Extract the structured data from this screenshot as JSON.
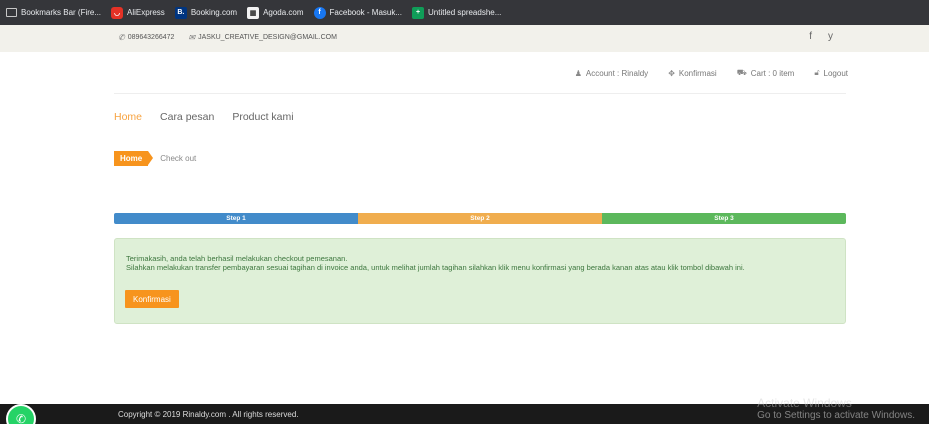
{
  "bookmarks": [
    {
      "label": "Bookmarks Bar (Fire...",
      "icon": "folder-icon"
    },
    {
      "label": "AliExpress",
      "icon": "aliexpress-icon"
    },
    {
      "label": "Booking.com",
      "icon": "booking-icon"
    },
    {
      "label": "Agoda.com",
      "icon": "agoda-icon"
    },
    {
      "label": "Facebook - Masuk...",
      "icon": "facebook-icon"
    },
    {
      "label": "Untitled spreadshe...",
      "icon": "sheets-icon"
    }
  ],
  "topbar": {
    "phone": "089643266472",
    "email": "JASKU_CREATIVE_DESIGN@GMAIL.COM",
    "social": [
      "f",
      "y"
    ]
  },
  "account_nav": {
    "account": "Account : Rinaldy",
    "konfirmasi": "Konfirmasi",
    "cart": "Cart : 0 item",
    "logout": "Logout"
  },
  "main_nav": {
    "home": "Home",
    "cara_pesan": "Cara pesan",
    "product": "Product kami"
  },
  "breadcrumb": {
    "home": "Home",
    "current": "Check out"
  },
  "steps": [
    {
      "label": "Step 1",
      "color": "#428bca"
    },
    {
      "label": "Step 2",
      "color": "#f0ad4e"
    },
    {
      "label": "Step 3",
      "color": "#5cb85c"
    }
  ],
  "alert": {
    "line1": "Terimakasih, anda telah berhasil melakukan checkout pemesanan.",
    "line2": "Silahkan melakukan transfer pembayaran sesuai tagihan di invoice anda, untuk melihat jumlah tagihan silahkan klik menu konfirmasi yang berada kanan atas atau klik tombol dibawah ini.",
    "button": "Konfirmasi"
  },
  "footer": {
    "copyright": "Copyright © 2019 Rinaldy.com . All rights reserved."
  },
  "watermark": {
    "title": "Activate Windows",
    "subtitle": "Go to Settings to activate Windows."
  },
  "colors": {
    "accent": "#f7941d",
    "alert_bg": "#dff0d8",
    "alert_text": "#3c763d"
  }
}
